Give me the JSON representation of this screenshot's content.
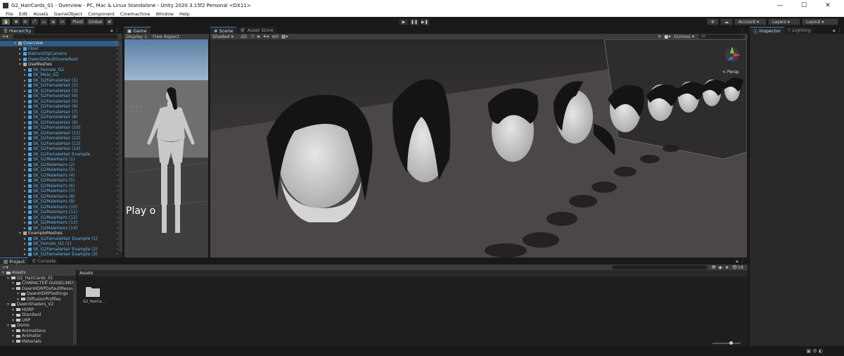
{
  "window": {
    "title": "G2_HairCards_01 - Overview - PC, Mac & Linux Standalone - Unity 2020.3.15f2 Personal <DX11>",
    "controls": [
      "—",
      "☐",
      "✕"
    ]
  },
  "menu": [
    "File",
    "Edit",
    "Assets",
    "GameObject",
    "Component",
    "Cinemachine",
    "Window",
    "Help"
  ],
  "toolbar": {
    "pivot": "Pivot",
    "global": "Global",
    "account": "Account",
    "layers": "Layers",
    "layout": "Layout"
  },
  "hierarchy": {
    "tab": "Hierarchy",
    "scene": "Overview",
    "items": [
      {
        "label": "Floor",
        "depth": 1
      },
      {
        "label": "Batrond3pCamera",
        "depth": 1
      },
      {
        "label": "DawnDefaultSceneRoot",
        "depth": 1
      },
      {
        "label": "UseMeshes",
        "depth": 1,
        "group": true
      },
      {
        "label": "SK_Female_G2",
        "depth": 2
      },
      {
        "label": "SK_Male_G2",
        "depth": 2
      },
      {
        "label": "SK_G2FemaleHair (1)",
        "depth": 2
      },
      {
        "label": "SK_G2FemaleHair (2)",
        "depth": 2
      },
      {
        "label": "SK_G2FemaleHair (3)",
        "depth": 2
      },
      {
        "label": "SK_G2FemaleHair (4)",
        "depth": 2
      },
      {
        "label": "SK_G2FemaleHair (5)",
        "depth": 2
      },
      {
        "label": "SK_G2FemaleHair (6)",
        "depth": 2
      },
      {
        "label": "SK_G2FemaleHair (7)",
        "depth": 2
      },
      {
        "label": "SK_G2FemaleHair (8)",
        "depth": 2
      },
      {
        "label": "SK_G2FemaleHair (9)",
        "depth": 2
      },
      {
        "label": "SK_G2FemaleHair (10)",
        "depth": 2
      },
      {
        "label": "SK_G2FemaleHair (11)",
        "depth": 2
      },
      {
        "label": "SK_G2FemaleHair (12)",
        "depth": 2
      },
      {
        "label": "SK_G2FemaleHair (13)",
        "depth": 2
      },
      {
        "label": "SK_G2FemaleHair (14)",
        "depth": 2
      },
      {
        "label": "SK_G2FemaleHair Example",
        "depth": 2
      },
      {
        "label": "SK_G2MaleHairs (1)",
        "depth": 2
      },
      {
        "label": "SK_G2MaleHairs (2)",
        "depth": 2
      },
      {
        "label": "SK_G2MaleHairs (3)",
        "depth": 2
      },
      {
        "label": "SK_G2MaleHairs (4)",
        "depth": 2
      },
      {
        "label": "SK_G2MaleHairs (5)",
        "depth": 2
      },
      {
        "label": "SK_G2MaleHairs (6)",
        "depth": 2
      },
      {
        "label": "SK_G2MaleHairs (7)",
        "depth": 2
      },
      {
        "label": "SK_G2MaleHairs (8)",
        "depth": 2
      },
      {
        "label": "SK_G2MaleHairs (9)",
        "depth": 2
      },
      {
        "label": "SK_G2MaleHairs (10)",
        "depth": 2
      },
      {
        "label": "SK_G2MaleHairs (11)",
        "depth": 2
      },
      {
        "label": "SK_G2MaleHairs (12)",
        "depth": 2
      },
      {
        "label": "SK_G2MaleHairs (13)",
        "depth": 2
      },
      {
        "label": "SK_G2MaleHairs (14)",
        "depth": 2
      },
      {
        "label": "ExampleMeshes",
        "depth": 1,
        "group": true
      },
      {
        "label": "SK_G2FemaleHair Example (1)",
        "depth": 2
      },
      {
        "label": "SK_Female_G2 (1)",
        "depth": 2
      },
      {
        "label": "SK_G2FemaleHair Example (2)",
        "depth": 2
      },
      {
        "label": "SK_G2FemaleHair Example (3)",
        "depth": 2
      }
    ]
  },
  "game": {
    "tab": "Game",
    "display": "Display 1",
    "aspect": "Free Aspect",
    "overlay_text": "Play o"
  },
  "scene": {
    "tab": "Scene",
    "asset_store_tab": "Asset Store",
    "shading": "Shaded",
    "mode_2d": "2D",
    "gizmos": "Gizmos",
    "persp": "< Persp",
    "search_placeholder": "All"
  },
  "inspector": {
    "tab": "Inspector",
    "lighting_tab": "Lighting"
  },
  "project": {
    "tab": "Project",
    "console_tab": "Console",
    "assets_root": "Assets",
    "tree": [
      {
        "label": "Assets",
        "depth": 0
      },
      {
        "label": "G2_HairCards_01",
        "depth": 1
      },
      {
        "label": "CHARACTER GUIDELINES",
        "depth": 2
      },
      {
        "label": "DawnHDRPDefaultResour",
        "depth": 2
      },
      {
        "label": "DawnHDRPSettings",
        "depth": 3
      },
      {
        "label": "DiffusionProfiles",
        "depth": 3
      },
      {
        "label": "DawnShaders_V2",
        "depth": 1
      },
      {
        "label": "HDRP",
        "depth": 2
      },
      {
        "label": "Standard",
        "depth": 2
      },
      {
        "label": "URP",
        "depth": 2
      },
      {
        "label": "Demo",
        "depth": 1
      },
      {
        "label": "Animations",
        "depth": 2
      },
      {
        "label": "Animator",
        "depth": 2
      },
      {
        "label": "Materials",
        "depth": 2
      }
    ],
    "breadcrumb": "Assets",
    "folder_label": "G2_HairCa...",
    "hidden_count": "18"
  },
  "colors": {
    "selection": "#2c5d87",
    "link_blue": "#5eb5f2",
    "panel": "#282828",
    "background": "#191919"
  }
}
